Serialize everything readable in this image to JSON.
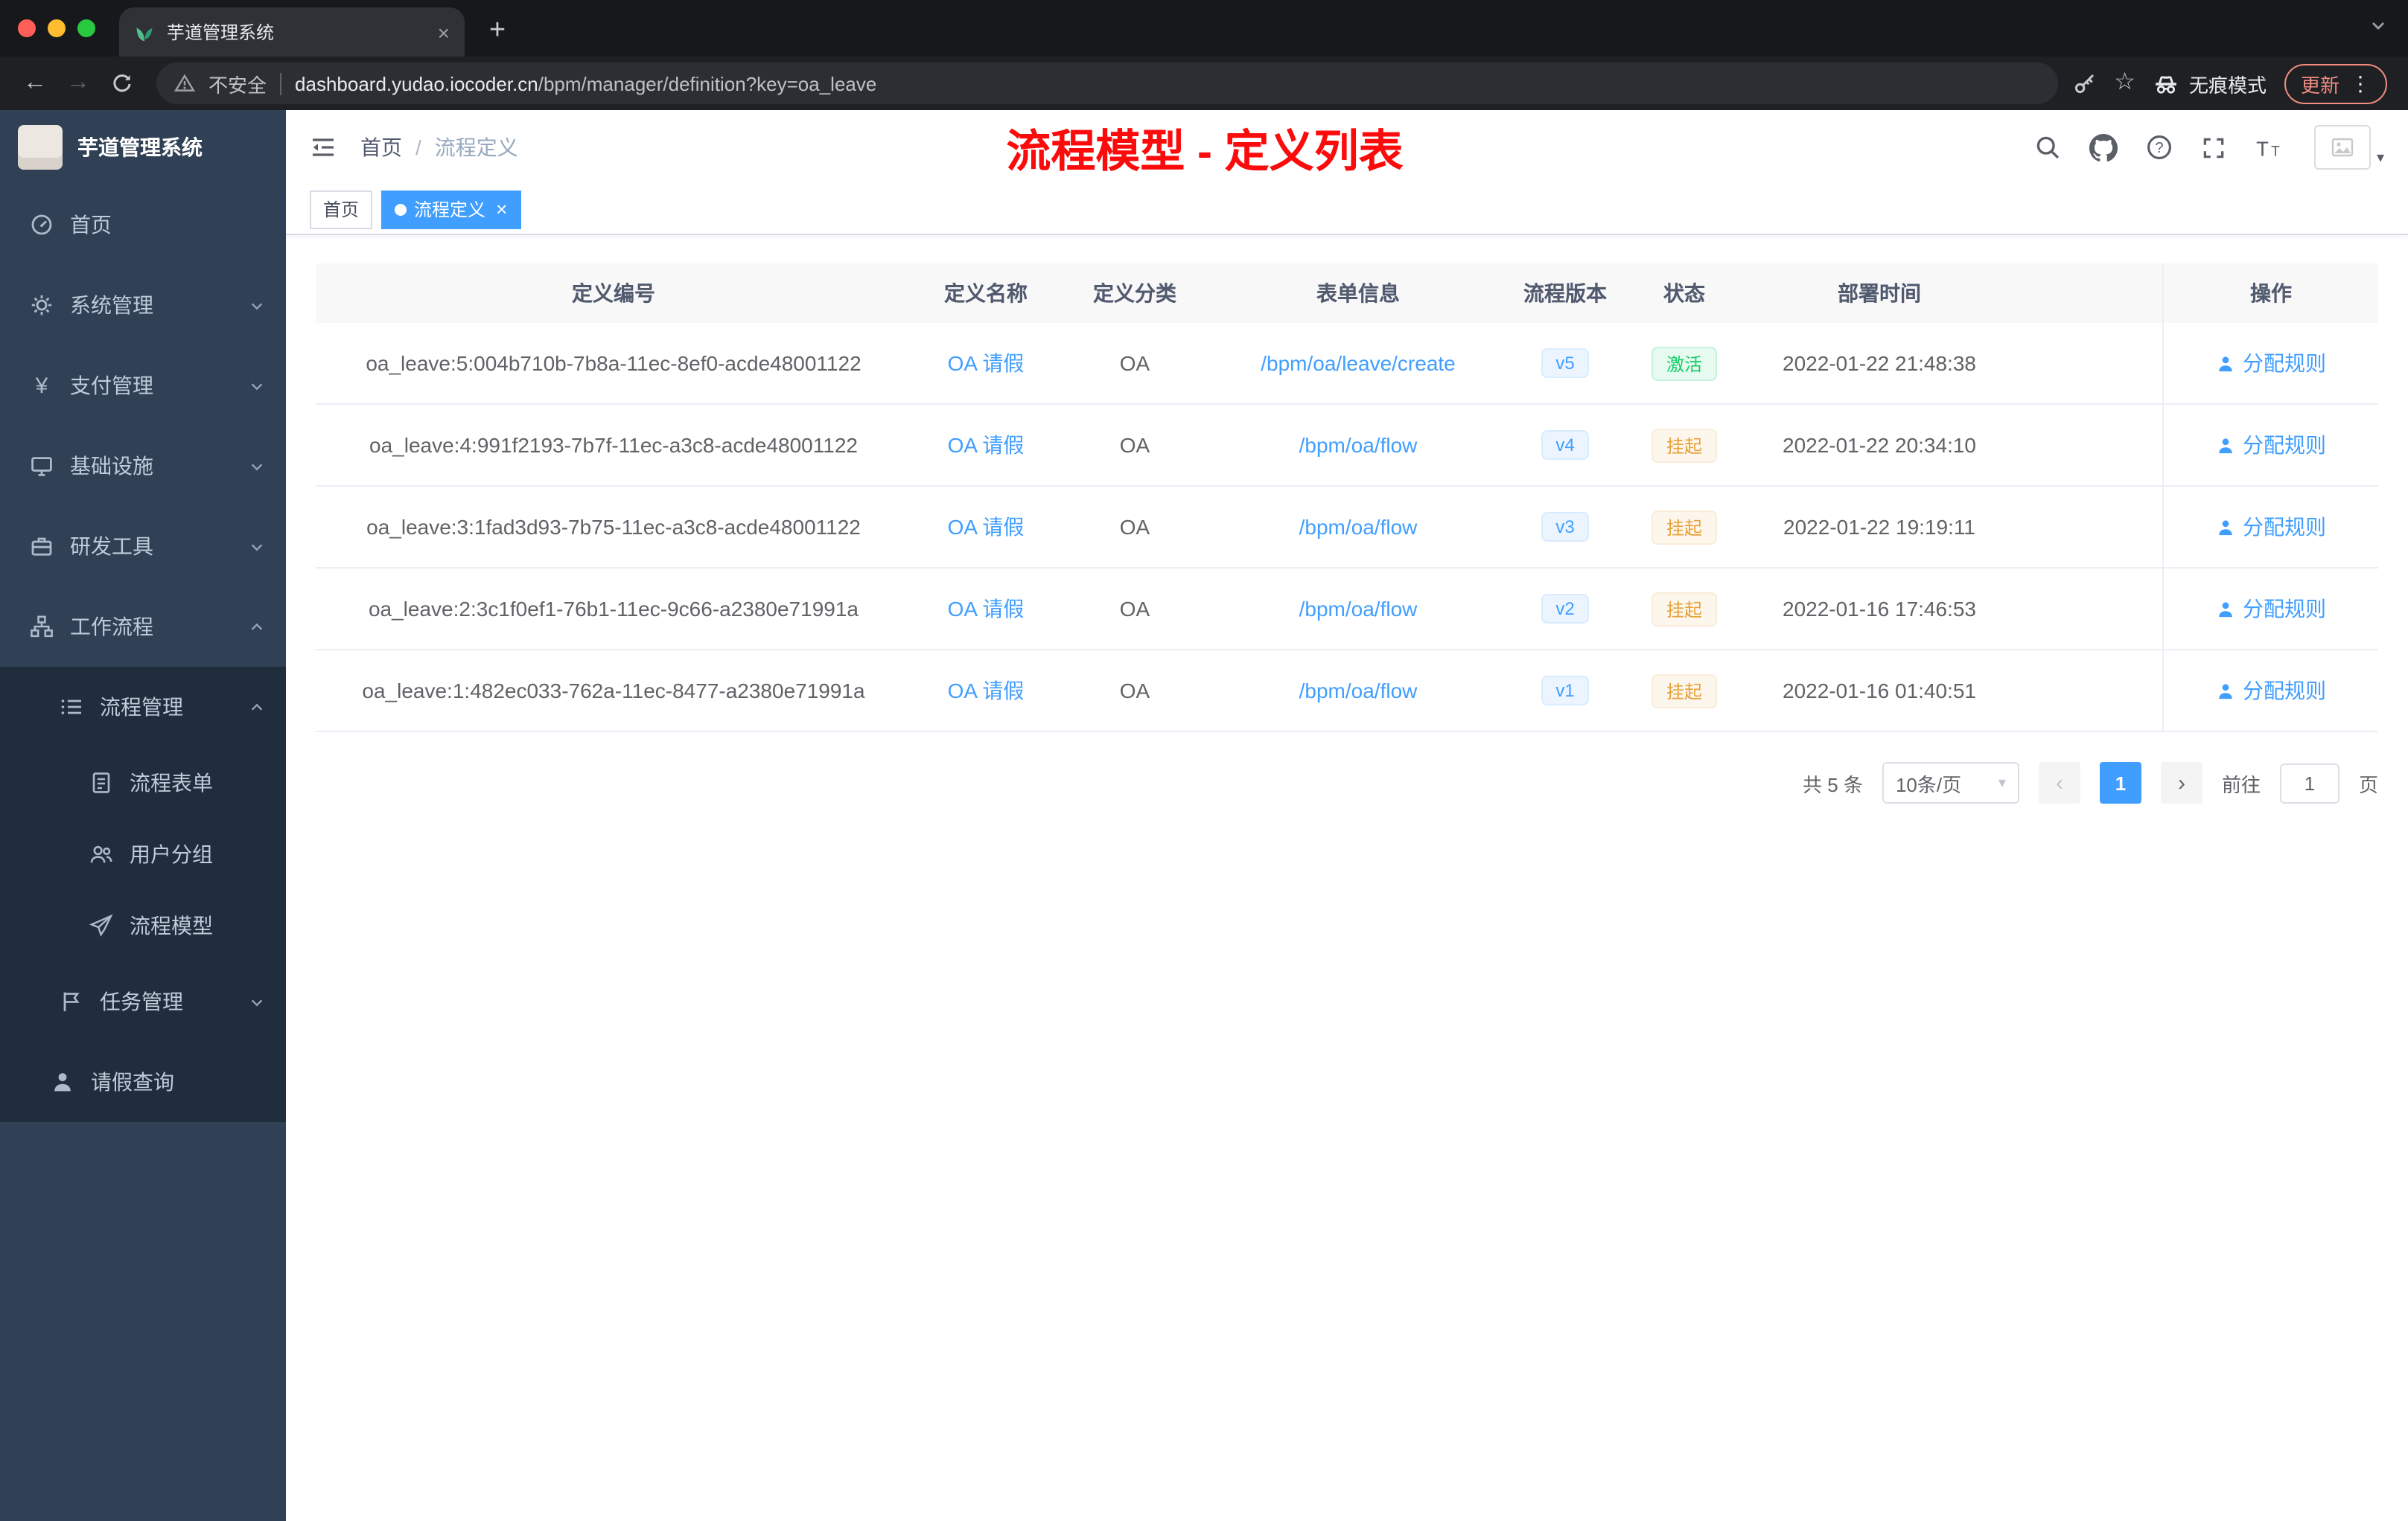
{
  "browser": {
    "tab_title": "芋道管理系统",
    "new_tab": "+",
    "security_label": "不安全",
    "url_domain": "dashboard.yudao.iocoder.cn",
    "url_path": "/bpm/manager/definition?key=oa_leave",
    "incognito_label": "无痕模式",
    "update_label": "更新"
  },
  "sidebar": {
    "app_title": "芋道管理系统",
    "items": [
      {
        "label": "首页"
      },
      {
        "label": "系统管理"
      },
      {
        "label": "支付管理"
      },
      {
        "label": "基础设施"
      },
      {
        "label": "研发工具"
      },
      {
        "label": "工作流程"
      },
      {
        "label": "流程管理"
      },
      {
        "label": "流程表单"
      },
      {
        "label": "用户分组"
      },
      {
        "label": "流程模型"
      },
      {
        "label": "任务管理"
      },
      {
        "label": "请假查询"
      }
    ]
  },
  "header": {
    "breadcrumb_home": "首页",
    "breadcrumb_separator": "/",
    "breadcrumb_current": "流程定义",
    "overlay_title": "流程模型 - 定义列表"
  },
  "tags": {
    "home": "首页",
    "active": "流程定义"
  },
  "table": {
    "columns": [
      "定义编号",
      "定义名称",
      "定义分类",
      "表单信息",
      "流程版本",
      "状态",
      "部署时间",
      "操作"
    ],
    "action_label": "分配规则",
    "rows": [
      {
        "id": "oa_leave:5:004b710b-7b8a-11ec-8ef0-acde48001122",
        "name": "OA 请假",
        "category": "OA",
        "form": "/bpm/oa/leave/create",
        "version": "v5",
        "status": "激活",
        "deployed": "2022-01-22 21:48:38"
      },
      {
        "id": "oa_leave:4:991f2193-7b7f-11ec-a3c8-acde48001122",
        "name": "OA 请假",
        "category": "OA",
        "form": "/bpm/oa/flow",
        "version": "v4",
        "status": "挂起",
        "deployed": "2022-01-22 20:34:10"
      },
      {
        "id": "oa_leave:3:1fad3d93-7b75-11ec-a3c8-acde48001122",
        "name": "OA 请假",
        "category": "OA",
        "form": "/bpm/oa/flow",
        "version": "v3",
        "status": "挂起",
        "deployed": "2022-01-22 19:19:11"
      },
      {
        "id": "oa_leave:2:3c1f0ef1-76b1-11ec-9c66-a2380e71991a",
        "name": "OA 请假",
        "category": "OA",
        "form": "/bpm/oa/flow",
        "version": "v2",
        "status": "挂起",
        "deployed": "2022-01-16 17:46:53"
      },
      {
        "id": "oa_leave:1:482ec033-762a-11ec-8477-a2380e71991a",
        "name": "OA 请假",
        "category": "OA",
        "form": "/bpm/oa/flow",
        "version": "v1",
        "status": "挂起",
        "deployed": "2022-01-16 01:40:51"
      }
    ]
  },
  "pagination": {
    "total": "共 5 条",
    "page_size": "10条/页",
    "prev": "‹",
    "page": "1",
    "next": "›",
    "goto_label": "前往",
    "goto_value": "1",
    "page_unit": "页"
  },
  "colors": {
    "accent": "#409eff",
    "overlay_title_red": "#fb0b0b",
    "status_active": "#13ce66",
    "status_suspended": "#e6a23c",
    "sidebar_bg": "#304156",
    "sidebar_submenu_bg": "#1f2d3d"
  }
}
